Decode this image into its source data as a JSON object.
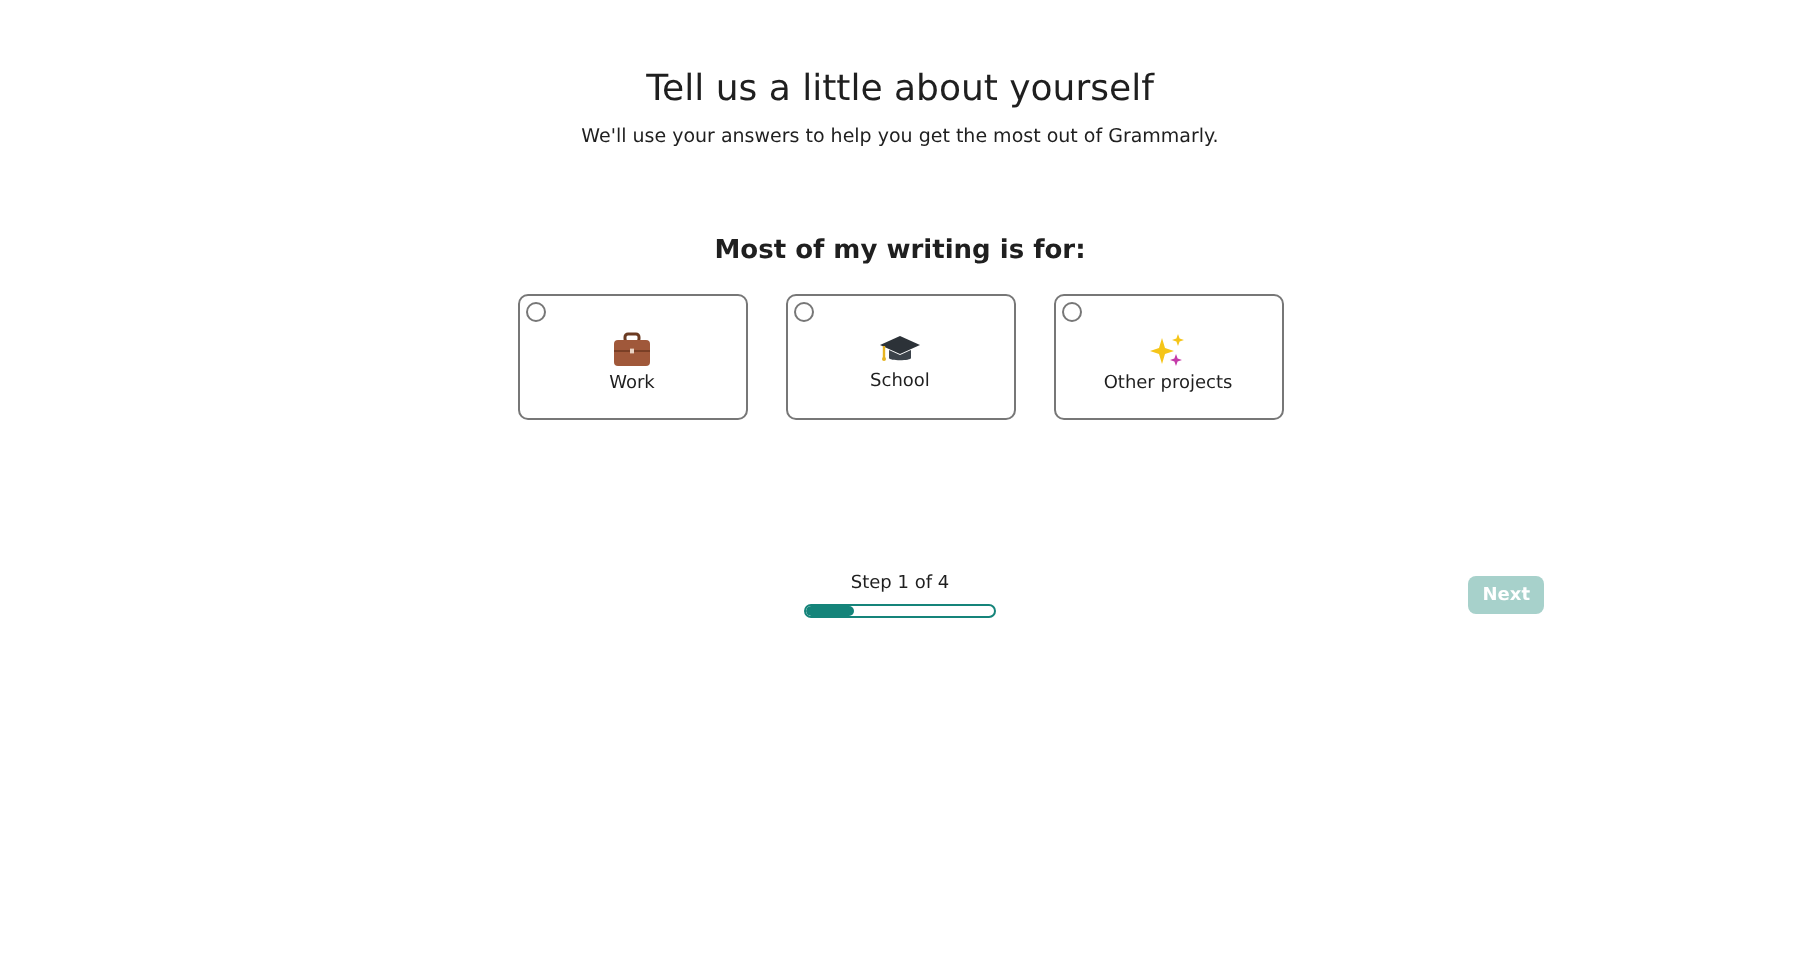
{
  "title": "Tell us a little about yourself",
  "subtitle": "We'll use your answers to help you get the most out of Grammarly.",
  "question": "Most of my writing is for:",
  "options": [
    {
      "kind": "briefcase",
      "label": "Work",
      "selected": false
    },
    {
      "kind": "cap",
      "label": "School",
      "selected": false
    },
    {
      "kind": "sparkles",
      "label": "Other projects",
      "selected": false
    }
  ],
  "progress": {
    "label": "Step 1 of 4",
    "level": 0.25
  },
  "next_button": {
    "label": "Next",
    "disabled": true
  }
}
